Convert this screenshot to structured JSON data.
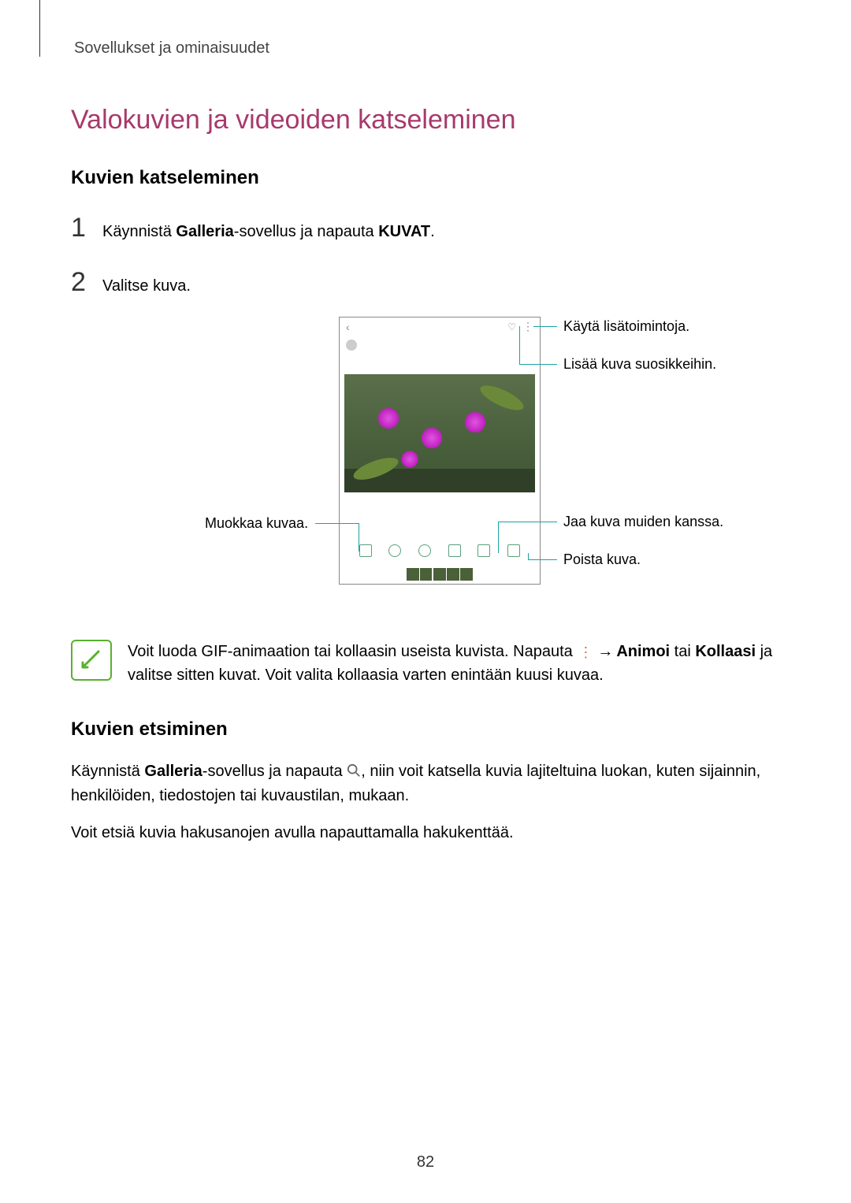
{
  "breadcrumb": "Sovellukset ja ominaisuudet",
  "section_title": "Valokuvien ja videoiden katseleminen",
  "sub1_title": "Kuvien katseleminen",
  "steps": {
    "num1": "1",
    "text1_a": "Käynnistä ",
    "text1_b": "Galleria",
    "text1_c": "-sovellus ja napauta ",
    "text1_d": "KUVAT",
    "text1_e": ".",
    "num2": "2",
    "text2": "Valitse kuva."
  },
  "callouts": {
    "more": "Käytä lisätoimintoja.",
    "fav": "Lisää kuva suosikkeihin.",
    "edit": "Muokkaa kuvaa.",
    "share": "Jaa kuva muiden kanssa.",
    "delete": "Poista kuva."
  },
  "note": {
    "line1_a": "Voit luoda GIF-animaation tai kollaasin useista kuvista. Napauta ",
    "arrow": "→",
    "line1_b": " ",
    "animoi": "Animoi",
    "tai": " tai ",
    "kollaasi": "Kollaasi",
    "line2": " ja valitse sitten kuvat. Voit valita kollaasia varten enintään kuusi kuvaa."
  },
  "sub2_title": "Kuvien etsiminen",
  "para2_a": "Käynnistä ",
  "para2_b": "Galleria",
  "para2_c": "-sovellus ja napauta ",
  "para2_d": ", niin voit katsella kuvia lajiteltuina luokan, kuten sijainnin, henkilöiden, tiedostojen tai kuvaustilan, mukaan.",
  "para3": "Voit etsiä kuvia hakusanojen avulla napauttamalla hakukenttää.",
  "page_number": "82"
}
